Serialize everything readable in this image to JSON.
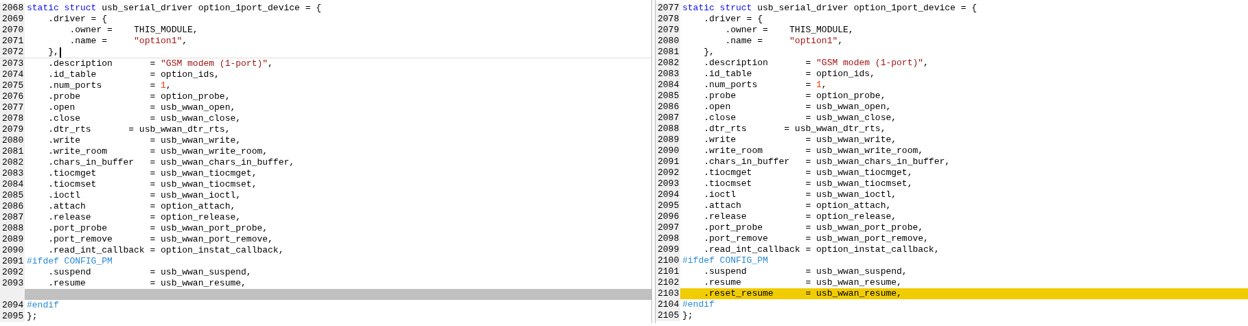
{
  "panes": [
    {
      "lines": [
        {
          "number": "2068",
          "kind": "normal",
          "cursor": false,
          "segments": [
            {
              "kind": "keyword",
              "text": "static struct"
            },
            {
              "kind": "plain",
              "text": " usb_serial_driver option_1port_device = {"
            }
          ]
        },
        {
          "number": "2069",
          "kind": "normal",
          "cursor": false,
          "segments": [
            {
              "kind": "plain",
              "text": "    .driver = {"
            }
          ]
        },
        {
          "number": "2070",
          "kind": "normal",
          "cursor": false,
          "segments": [
            {
              "kind": "plain",
              "text": "        .owner =    THIS_MODULE,"
            }
          ]
        },
        {
          "number": "2071",
          "kind": "normal",
          "cursor": false,
          "segments": [
            {
              "kind": "plain",
              "text": "        .name =     "
            },
            {
              "kind": "string",
              "text": "\"option1\""
            },
            {
              "kind": "plain",
              "text": ","
            }
          ]
        },
        {
          "number": "2072",
          "kind": "normal",
          "cursor": true,
          "segments": [
            {
              "kind": "plain",
              "text": "    },"
            }
          ]
        },
        {
          "number": "2073",
          "kind": "normal",
          "cursor": false,
          "segments": [
            {
              "kind": "plain",
              "text": "    .description       = "
            },
            {
              "kind": "string",
              "text": "\"GSM modem (1-port)\""
            },
            {
              "kind": "plain",
              "text": ","
            }
          ]
        },
        {
          "number": "2074",
          "kind": "normal",
          "cursor": false,
          "segments": [
            {
              "kind": "plain",
              "text": "    .id_table          = option_ids,"
            }
          ]
        },
        {
          "number": "2075",
          "kind": "normal",
          "cursor": false,
          "segments": [
            {
              "kind": "plain",
              "text": "    .num_ports         = "
            },
            {
              "kind": "number",
              "text": "1"
            },
            {
              "kind": "plain",
              "text": ","
            }
          ]
        },
        {
          "number": "2076",
          "kind": "normal",
          "cursor": false,
          "segments": [
            {
              "kind": "plain",
              "text": "    .probe             = option_probe,"
            }
          ]
        },
        {
          "number": "2077",
          "kind": "normal",
          "cursor": false,
          "segments": [
            {
              "kind": "plain",
              "text": "    .open              = usb_wwan_open,"
            }
          ]
        },
        {
          "number": "2078",
          "kind": "normal",
          "cursor": false,
          "segments": [
            {
              "kind": "plain",
              "text": "    .close             = usb_wwan_close,"
            }
          ]
        },
        {
          "number": "2079",
          "kind": "normal",
          "cursor": false,
          "segments": [
            {
              "kind": "plain",
              "text": "    .dtr_rts       = usb_wwan_dtr_rts,"
            }
          ]
        },
        {
          "number": "2080",
          "kind": "normal",
          "cursor": false,
          "segments": [
            {
              "kind": "plain",
              "text": "    .write             = usb_wwan_write,"
            }
          ]
        },
        {
          "number": "2081",
          "kind": "normal",
          "cursor": false,
          "segments": [
            {
              "kind": "plain",
              "text": "    .write_room        = usb_wwan_write_room,"
            }
          ]
        },
        {
          "number": "2082",
          "kind": "normal",
          "cursor": false,
          "segments": [
            {
              "kind": "plain",
              "text": "    .chars_in_buffer   = usb_wwan_chars_in_buffer,"
            }
          ]
        },
        {
          "number": "2083",
          "kind": "normal",
          "cursor": false,
          "segments": [
            {
              "kind": "plain",
              "text": "    .tiocmget          = usb_wwan_tiocmget,"
            }
          ]
        },
        {
          "number": "2084",
          "kind": "normal",
          "cursor": false,
          "segments": [
            {
              "kind": "plain",
              "text": "    .tiocmset          = usb_wwan_tiocmset,"
            }
          ]
        },
        {
          "number": "2085",
          "kind": "normal",
          "cursor": false,
          "segments": [
            {
              "kind": "plain",
              "text": "    .ioctl             = usb_wwan_ioctl,"
            }
          ]
        },
        {
          "number": "2086",
          "kind": "normal",
          "cursor": false,
          "segments": [
            {
              "kind": "plain",
              "text": "    .attach            = option_attach,"
            }
          ]
        },
        {
          "number": "2087",
          "kind": "normal",
          "cursor": false,
          "segments": [
            {
              "kind": "plain",
              "text": "    .release           = option_release,"
            }
          ]
        },
        {
          "number": "2088",
          "kind": "normal",
          "cursor": false,
          "segments": [
            {
              "kind": "plain",
              "text": "    .port_probe        = usb_wwan_port_probe,"
            }
          ]
        },
        {
          "number": "2089",
          "kind": "normal",
          "cursor": false,
          "segments": [
            {
              "kind": "plain",
              "text": "    .port_remove       = usb_wwan_port_remove,"
            }
          ]
        },
        {
          "number": "2090",
          "kind": "normal",
          "cursor": false,
          "segments": [
            {
              "kind": "plain",
              "text": "    .read_int_callback = option_instat_callback,"
            }
          ]
        },
        {
          "number": "2091",
          "kind": "normal",
          "cursor": false,
          "segments": [
            {
              "kind": "preproc",
              "text": "#ifdef CONFIG_PM"
            }
          ]
        },
        {
          "number": "2092",
          "kind": "normal",
          "cursor": false,
          "segments": [
            {
              "kind": "plain",
              "text": "    .suspend           = usb_wwan_suspend,"
            }
          ]
        },
        {
          "number": "2093",
          "kind": "normal",
          "cursor": false,
          "segments": [
            {
              "kind": "plain",
              "text": "    .resume            = usb_wwan_resume,"
            }
          ]
        },
        {
          "kind": "gap",
          "cursor": false
        },
        {
          "number": "2094",
          "kind": "normal",
          "cursor": false,
          "segments": [
            {
              "kind": "preproc",
              "text": "#endif"
            }
          ]
        },
        {
          "number": "2095",
          "kind": "normal",
          "cursor": false,
          "segments": [
            {
              "kind": "plain",
              "text": "};"
            }
          ]
        }
      ]
    },
    {
      "lines": [
        {
          "number": "2077",
          "kind": "normal",
          "cursor": false,
          "segments": [
            {
              "kind": "keyword",
              "text": "static struct"
            },
            {
              "kind": "plain",
              "text": " usb_serial_driver option_1port_device = {"
            }
          ]
        },
        {
          "number": "2078",
          "kind": "normal",
          "cursor": false,
          "segments": [
            {
              "kind": "plain",
              "text": "    .driver = {"
            }
          ]
        },
        {
          "number": "2079",
          "kind": "normal",
          "cursor": false,
          "segments": [
            {
              "kind": "plain",
              "text": "        .owner =    THIS_MODULE,"
            }
          ]
        },
        {
          "number": "2080",
          "kind": "normal",
          "cursor": false,
          "segments": [
            {
              "kind": "plain",
              "text": "        .name =     "
            },
            {
              "kind": "string",
              "text": "\"option1\""
            },
            {
              "kind": "plain",
              "text": ","
            }
          ]
        },
        {
          "number": "2081",
          "kind": "normal",
          "cursor": false,
          "segments": [
            {
              "kind": "plain",
              "text": "    },"
            }
          ]
        },
        {
          "number": "2082",
          "kind": "normal",
          "cursor": false,
          "segments": [
            {
              "kind": "plain",
              "text": "    .description       = "
            },
            {
              "kind": "string",
              "text": "\"GSM modem (1-port)\""
            },
            {
              "kind": "plain",
              "text": ","
            }
          ]
        },
        {
          "number": "2083",
          "kind": "normal",
          "cursor": false,
          "segments": [
            {
              "kind": "plain",
              "text": "    .id_table          = option_ids,"
            }
          ]
        },
        {
          "number": "2084",
          "kind": "normal",
          "cursor": false,
          "segments": [
            {
              "kind": "plain",
              "text": "    .num_ports         = "
            },
            {
              "kind": "number",
              "text": "1"
            },
            {
              "kind": "plain",
              "text": ","
            }
          ]
        },
        {
          "number": "2085",
          "kind": "normal",
          "cursor": false,
          "segments": [
            {
              "kind": "plain",
              "text": "    .probe             = option_probe,"
            }
          ]
        },
        {
          "number": "2086",
          "kind": "normal",
          "cursor": false,
          "segments": [
            {
              "kind": "plain",
              "text": "    .open              = usb_wwan_open,"
            }
          ]
        },
        {
          "number": "2087",
          "kind": "normal",
          "cursor": false,
          "segments": [
            {
              "kind": "plain",
              "text": "    .close             = usb_wwan_close,"
            }
          ]
        },
        {
          "number": "2088",
          "kind": "normal",
          "cursor": false,
          "segments": [
            {
              "kind": "plain",
              "text": "    .dtr_rts       = usb_wwan_dtr_rts,"
            }
          ]
        },
        {
          "number": "2089",
          "kind": "normal",
          "cursor": false,
          "segments": [
            {
              "kind": "plain",
              "text": "    .write             = usb_wwan_write,"
            }
          ]
        },
        {
          "number": "2090",
          "kind": "normal",
          "cursor": false,
          "segments": [
            {
              "kind": "plain",
              "text": "    .write_room        = usb_wwan_write_room,"
            }
          ]
        },
        {
          "number": "2091",
          "kind": "normal",
          "cursor": false,
          "segments": [
            {
              "kind": "plain",
              "text": "    .chars_in_buffer   = usb_wwan_chars_in_buffer,"
            }
          ]
        },
        {
          "number": "2092",
          "kind": "normal",
          "cursor": false,
          "segments": [
            {
              "kind": "plain",
              "text": "    .tiocmget          = usb_wwan_tiocmget,"
            }
          ]
        },
        {
          "number": "2093",
          "kind": "normal",
          "cursor": false,
          "segments": [
            {
              "kind": "plain",
              "text": "    .tiocmset          = usb_wwan_tiocmset,"
            }
          ]
        },
        {
          "number": "2094",
          "kind": "normal",
          "cursor": false,
          "segments": [
            {
              "kind": "plain",
              "text": "    .ioctl             = usb_wwan_ioctl,"
            }
          ]
        },
        {
          "number": "2095",
          "kind": "normal",
          "cursor": false,
          "segments": [
            {
              "kind": "plain",
              "text": "    .attach            = option_attach,"
            }
          ]
        },
        {
          "number": "2096",
          "kind": "normal",
          "cursor": false,
          "segments": [
            {
              "kind": "plain",
              "text": "    .release           = option_release,"
            }
          ]
        },
        {
          "number": "2097",
          "kind": "normal",
          "cursor": false,
          "segments": [
            {
              "kind": "plain",
              "text": "    .port_probe        = usb_wwan_port_probe,"
            }
          ]
        },
        {
          "number": "2098",
          "kind": "normal",
          "cursor": false,
          "segments": [
            {
              "kind": "plain",
              "text": "    .port_remove       = usb_wwan_port_remove,"
            }
          ]
        },
        {
          "number": "2099",
          "kind": "normal",
          "cursor": false,
          "segments": [
            {
              "kind": "plain",
              "text": "    .read_int_callback = option_instat_callback,"
            }
          ]
        },
        {
          "number": "2100",
          "kind": "normal",
          "cursor": false,
          "segments": [
            {
              "kind": "preproc",
              "text": "#ifdef CONFIG_PM"
            }
          ]
        },
        {
          "number": "2101",
          "kind": "normal",
          "cursor": false,
          "segments": [
            {
              "kind": "plain",
              "text": "    .suspend           = usb_wwan_suspend,"
            }
          ]
        },
        {
          "number": "2102",
          "kind": "normal",
          "cursor": false,
          "segments": [
            {
              "kind": "plain",
              "text": "    .resume            = usb_wwan_resume,"
            }
          ]
        },
        {
          "number": "2103",
          "kind": "added",
          "cursor": false,
          "segments": [
            {
              "kind": "plain",
              "text": "    .reset_resume      = usb_wwan_resume,"
            }
          ]
        },
        {
          "number": "2104",
          "kind": "normal",
          "cursor": false,
          "segments": [
            {
              "kind": "preproc",
              "text": "#endif"
            }
          ]
        },
        {
          "number": "2105",
          "kind": "normal",
          "cursor": false,
          "segments": [
            {
              "kind": "plain",
              "text": "};"
            }
          ]
        }
      ]
    }
  ]
}
